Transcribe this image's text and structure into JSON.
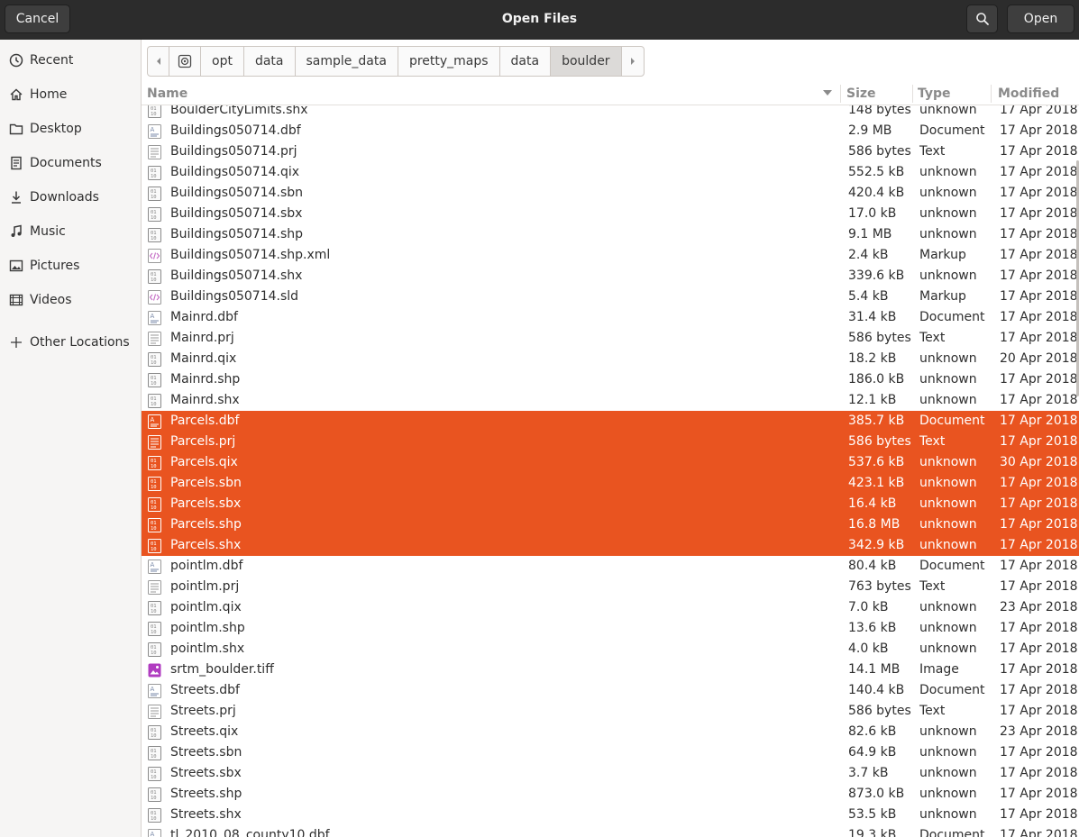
{
  "window": {
    "title": "Open Files",
    "cancel_label": "Cancel",
    "open_label": "Open",
    "search_icon": "search-icon"
  },
  "sidebar": {
    "items": [
      {
        "label": "Recent",
        "icon": "clock-icon"
      },
      {
        "label": "Home",
        "icon": "home-icon"
      },
      {
        "label": "Desktop",
        "icon": "folder-icon"
      },
      {
        "label": "Documents",
        "icon": "document-icon"
      },
      {
        "label": "Downloads",
        "icon": "download-icon"
      },
      {
        "label": "Music",
        "icon": "music-icon"
      },
      {
        "label": "Pictures",
        "icon": "picture-icon"
      },
      {
        "label": "Videos",
        "icon": "video-icon"
      },
      {
        "label": "Other Locations",
        "icon": "plus-icon"
      }
    ]
  },
  "pathbar": {
    "segments": [
      "opt",
      "data",
      "sample_data",
      "pretty_maps",
      "data",
      "boulder"
    ],
    "current": "boulder"
  },
  "columns": {
    "name": "Name",
    "size": "Size",
    "type": "Type",
    "modified": "Modified"
  },
  "files": [
    {
      "name": "BoulderCityLimits.shx",
      "size": "148 bytes",
      "type": "unknown",
      "modified": "17 Apr 2018",
      "icon": "binary",
      "selected": false
    },
    {
      "name": "Buildings050714.dbf",
      "size": "2.9 MB",
      "type": "Document",
      "modified": "17 Apr 2018",
      "icon": "doc",
      "selected": false
    },
    {
      "name": "Buildings050714.prj",
      "size": "586 bytes",
      "type": "Text",
      "modified": "17 Apr 2018",
      "icon": "text",
      "selected": false
    },
    {
      "name": "Buildings050714.qix",
      "size": "552.5 kB",
      "type": "unknown",
      "modified": "17 Apr 2018",
      "icon": "binary",
      "selected": false
    },
    {
      "name": "Buildings050714.sbn",
      "size": "420.4 kB",
      "type": "unknown",
      "modified": "17 Apr 2018",
      "icon": "binary",
      "selected": false
    },
    {
      "name": "Buildings050714.sbx",
      "size": "17.0 kB",
      "type": "unknown",
      "modified": "17 Apr 2018",
      "icon": "binary",
      "selected": false
    },
    {
      "name": "Buildings050714.shp",
      "size": "9.1 MB",
      "type": "unknown",
      "modified": "17 Apr 2018",
      "icon": "binary",
      "selected": false
    },
    {
      "name": "Buildings050714.shp.xml",
      "size": "2.4 kB",
      "type": "Markup",
      "modified": "17 Apr 2018",
      "icon": "markup",
      "selected": false
    },
    {
      "name": "Buildings050714.shx",
      "size": "339.6 kB",
      "type": "unknown",
      "modified": "17 Apr 2018",
      "icon": "binary",
      "selected": false
    },
    {
      "name": "Buildings050714.sld",
      "size": "5.4 kB",
      "type": "Markup",
      "modified": "17 Apr 2018",
      "icon": "markup",
      "selected": false
    },
    {
      "name": "Mainrd.dbf",
      "size": "31.4 kB",
      "type": "Document",
      "modified": "17 Apr 2018",
      "icon": "doc",
      "selected": false
    },
    {
      "name": "Mainrd.prj",
      "size": "586 bytes",
      "type": "Text",
      "modified": "17 Apr 2018",
      "icon": "text",
      "selected": false
    },
    {
      "name": "Mainrd.qix",
      "size": "18.2 kB",
      "type": "unknown",
      "modified": "20 Apr 2018",
      "icon": "binary",
      "selected": false
    },
    {
      "name": "Mainrd.shp",
      "size": "186.0 kB",
      "type": "unknown",
      "modified": "17 Apr 2018",
      "icon": "binary",
      "selected": false
    },
    {
      "name": "Mainrd.shx",
      "size": "12.1 kB",
      "type": "unknown",
      "modified": "17 Apr 2018",
      "icon": "binary",
      "selected": false
    },
    {
      "name": "Parcels.dbf",
      "size": "385.7 kB",
      "type": "Document",
      "modified": "17 Apr 2018",
      "icon": "doc",
      "selected": true
    },
    {
      "name": "Parcels.prj",
      "size": "586 bytes",
      "type": "Text",
      "modified": "17 Apr 2018",
      "icon": "text",
      "selected": true
    },
    {
      "name": "Parcels.qix",
      "size": "537.6 kB",
      "type": "unknown",
      "modified": "30 Apr 2018",
      "icon": "binary",
      "selected": true
    },
    {
      "name": "Parcels.sbn",
      "size": "423.1 kB",
      "type": "unknown",
      "modified": "17 Apr 2018",
      "icon": "binary",
      "selected": true
    },
    {
      "name": "Parcels.sbx",
      "size": "16.4 kB",
      "type": "unknown",
      "modified": "17 Apr 2018",
      "icon": "binary",
      "selected": true
    },
    {
      "name": "Parcels.shp",
      "size": "16.8 MB",
      "type": "unknown",
      "modified": "17 Apr 2018",
      "icon": "binary",
      "selected": true
    },
    {
      "name": "Parcels.shx",
      "size": "342.9 kB",
      "type": "unknown",
      "modified": "17 Apr 2018",
      "icon": "binary",
      "selected": true
    },
    {
      "name": "pointlm.dbf",
      "size": "80.4 kB",
      "type": "Document",
      "modified": "17 Apr 2018",
      "icon": "doc",
      "selected": false
    },
    {
      "name": "pointlm.prj",
      "size": "763 bytes",
      "type": "Text",
      "modified": "17 Apr 2018",
      "icon": "text",
      "selected": false
    },
    {
      "name": "pointlm.qix",
      "size": "7.0 kB",
      "type": "unknown",
      "modified": "23 Apr 2018",
      "icon": "binary",
      "selected": false
    },
    {
      "name": "pointlm.shp",
      "size": "13.6 kB",
      "type": "unknown",
      "modified": "17 Apr 2018",
      "icon": "binary",
      "selected": false
    },
    {
      "name": "pointlm.shx",
      "size": "4.0 kB",
      "type": "unknown",
      "modified": "17 Apr 2018",
      "icon": "binary",
      "selected": false
    },
    {
      "name": "srtm_boulder.tiff",
      "size": "14.1 MB",
      "type": "Image",
      "modified": "17 Apr 2018",
      "icon": "image",
      "selected": false
    },
    {
      "name": "Streets.dbf",
      "size": "140.4 kB",
      "type": "Document",
      "modified": "17 Apr 2018",
      "icon": "doc",
      "selected": false
    },
    {
      "name": "Streets.prj",
      "size": "586 bytes",
      "type": "Text",
      "modified": "17 Apr 2018",
      "icon": "text",
      "selected": false
    },
    {
      "name": "Streets.qix",
      "size": "82.6 kB",
      "type": "unknown",
      "modified": "23 Apr 2018",
      "icon": "binary",
      "selected": false
    },
    {
      "name": "Streets.sbn",
      "size": "64.9 kB",
      "type": "unknown",
      "modified": "17 Apr 2018",
      "icon": "binary",
      "selected": false
    },
    {
      "name": "Streets.sbx",
      "size": "3.7 kB",
      "type": "unknown",
      "modified": "17 Apr 2018",
      "icon": "binary",
      "selected": false
    },
    {
      "name": "Streets.shp",
      "size": "873.0 kB",
      "type": "unknown",
      "modified": "17 Apr 2018",
      "icon": "binary",
      "selected": false
    },
    {
      "name": "Streets.shx",
      "size": "53.5 kB",
      "type": "unknown",
      "modified": "17 Apr 2018",
      "icon": "binary",
      "selected": false
    },
    {
      "name": "tl_2010_08_county10.dbf",
      "size": "19.3 kB",
      "type": "Document",
      "modified": "17 Apr 2018",
      "icon": "doc",
      "selected": false
    }
  ],
  "colors": {
    "header_bg": "#2c2c2c",
    "selection": "#e95420",
    "sidebar_bg": "#f6f5f4"
  }
}
